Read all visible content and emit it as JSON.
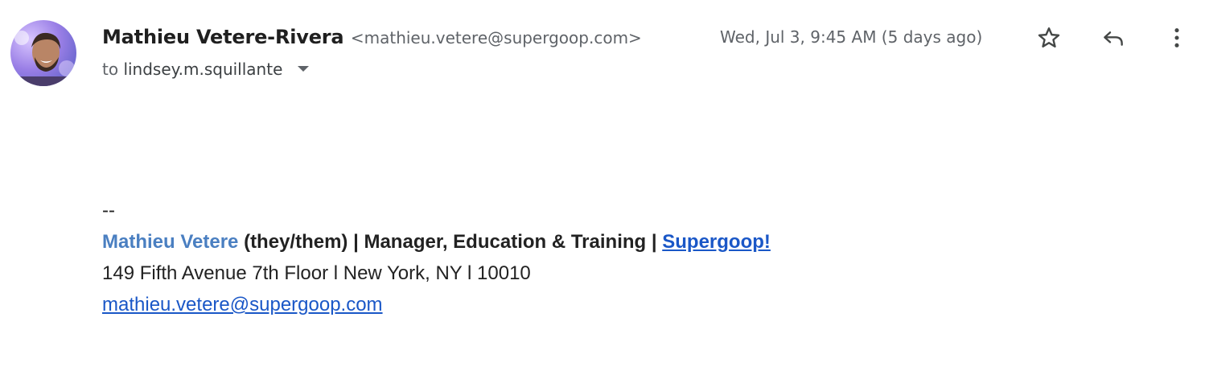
{
  "message": {
    "sender_name": "Mathieu Vetere-Rivera",
    "sender_email": "<mathieu.vetere@supergoop.com>",
    "to_prefix": "to",
    "to_recipient": "lindsey.m.squillante",
    "timestamp": "Wed, Jul 3, 9:45 AM (5 days ago)"
  },
  "actions": {
    "star_icon": "star-icon",
    "reply_icon": "reply-icon",
    "more_icon": "more-vert-icon"
  },
  "signature": {
    "separator": "--",
    "name": "Mathieu Vetere",
    "pronouns_title": " (they/them) | Manager, Education & Training | ",
    "company_link": "Supergoop!",
    "address": "149 Fifth Avenue 7th Floor l New York, NY l 10010",
    "email_link": "mathieu.vetere@supergoop.com"
  },
  "colors": {
    "link": "#1a57c7",
    "signature_name": "#4a7fc1",
    "secondary_text": "#5f6368"
  }
}
